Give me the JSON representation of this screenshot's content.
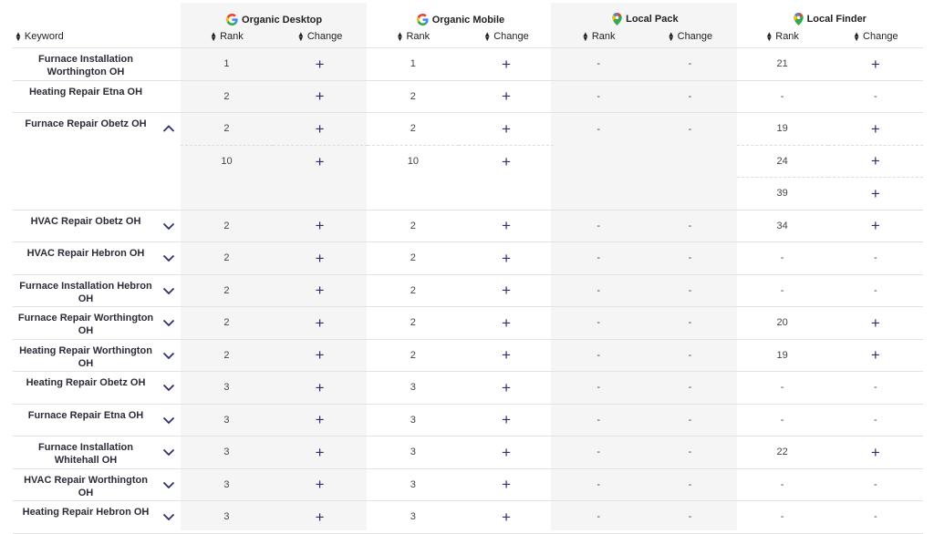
{
  "header": {
    "keyword_label": "Keyword",
    "rank_label": "Rank",
    "change_label": "Change",
    "groups": [
      "Organic Desktop",
      "Organic Mobile",
      "Local Pack",
      "Local Finder"
    ]
  },
  "colors": {
    "accent": "#2f2f6e",
    "band": "#f5f5f5",
    "border": "#e2e2e2"
  },
  "rows": [
    {
      "keyword": "Furnace Installation Worthington OH",
      "od": "1",
      "om": "1",
      "lp": "-",
      "lpc": "-",
      "lf": "21",
      "lfc": "plus",
      "chev": "none"
    },
    {
      "keyword": "Heating Repair Etna OH",
      "od": "2",
      "om": "2",
      "lp": "-",
      "lpc": "-",
      "lf": "-",
      "lfc": "-",
      "chev": "none"
    },
    {
      "keyword": "Furnace Repair Obetz OH",
      "od": "2",
      "om": "2",
      "lp": "-",
      "lpc": "-",
      "lf": "19",
      "lfc": "plus",
      "chev": "up",
      "extra": [
        {
          "od": "10",
          "om": "10",
          "lf": "24"
        },
        {
          "lf": "39"
        }
      ]
    },
    {
      "keyword": "HVAC Repair Obetz OH",
      "od": "2",
      "om": "2",
      "lp": "-",
      "lpc": "-",
      "lf": "34",
      "lfc": "plus",
      "chev": "down"
    },
    {
      "keyword": "HVAC Repair Hebron OH",
      "od": "2",
      "om": "2",
      "lp": "-",
      "lpc": "-",
      "lf": "-",
      "lfc": "-",
      "chev": "down"
    },
    {
      "keyword": "Furnace Installation Hebron OH",
      "od": "2",
      "om": "2",
      "lp": "-",
      "lpc": "-",
      "lf": "-",
      "lfc": "-",
      "chev": "down"
    },
    {
      "keyword": "Furnace Repair Worthington OH",
      "od": "2",
      "om": "2",
      "lp": "-",
      "lpc": "-",
      "lf": "20",
      "lfc": "plus",
      "chev": "down"
    },
    {
      "keyword": "Heating Repair Worthington OH",
      "od": "2",
      "om": "2",
      "lp": "-",
      "lpc": "-",
      "lf": "19",
      "lfc": "plus",
      "chev": "down"
    },
    {
      "keyword": "Heating Repair Obetz OH",
      "od": "3",
      "om": "3",
      "lp": "-",
      "lpc": "-",
      "lf": "-",
      "lfc": "-",
      "chev": "down"
    },
    {
      "keyword": "Furnace Repair Etna OH",
      "od": "3",
      "om": "3",
      "lp": "-",
      "lpc": "-",
      "lf": "-",
      "lfc": "-",
      "chev": "down"
    },
    {
      "keyword": "Furnace Installation Whitehall OH",
      "od": "3",
      "om": "3",
      "lp": "-",
      "lpc": "-",
      "lf": "22",
      "lfc": "plus",
      "chev": "down"
    },
    {
      "keyword": "HVAC Repair Worthington OH",
      "od": "3",
      "om": "3",
      "lp": "-",
      "lpc": "-",
      "lf": "-",
      "lfc": "-",
      "chev": "down"
    },
    {
      "keyword": "Heating Repair Hebron OH",
      "od": "3",
      "om": "3",
      "lp": "-",
      "lpc": "-",
      "lf": "-",
      "lfc": "-",
      "chev": "down"
    }
  ]
}
